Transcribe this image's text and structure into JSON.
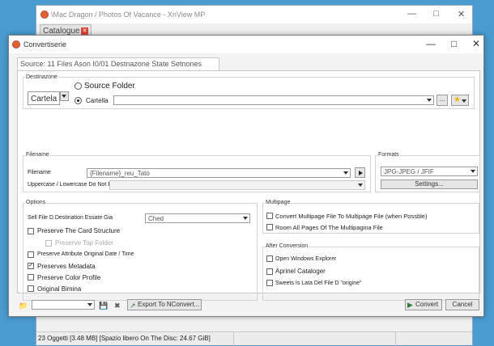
{
  "background_window": {
    "title": "\\Mac Dragon / Photos Of Vacance - XnView MP",
    "tab_label": "Catalogue",
    "status_text": "23 Oggetti [3.48 MB] [Spazio libero On The Disc: 24.67 GiB]"
  },
  "dialog": {
    "title": "Convertiserie",
    "tab_label": "Source: 11 Files Ason I0/01 Destnazone State Setnones",
    "destination": {
      "group_label": "Destinazone",
      "mode_value": "Cartela",
      "source_folder_label": "Source Folder",
      "cartella_label": "Cartella",
      "folder_path": "",
      "browse_label": "..."
    },
    "filename": {
      "group_label": "Filename",
      "filename_label": "Filename",
      "filename_value": "{Filename}_reu_Tato",
      "case_label": "Uppercase / Lowercase Do Not Edit",
      "case_value": ""
    },
    "formats": {
      "group_label": "Formats",
      "format_value": "JPG-JPEG / JFIF",
      "settings_label": "Settings..."
    },
    "options": {
      "group_label": "Options",
      "if_exists_label": "Sell File D Destination Essate Gia",
      "if_exists_value": "Ched",
      "preserve_card_structure": "Preserve The Card Structure",
      "preserve_top_folder": "Preserve Top Folder",
      "preserve_date": "Preserve Attribute Original Date / Time",
      "preserve_metadata": "Preserves Metadata",
      "preserve_color_profile": "Preserve Color Profile",
      "original_delete": "Original Bimina"
    },
    "multipage": {
      "group_label": "Multipage",
      "convert_multipage": "Convert Multipage File To Multipage File (when Possble)",
      "room_all_pages": "Room All Pages Of The Multipagina File"
    },
    "after_conversion": {
      "group_label": "After Conversion",
      "open_explorer": "Open Windows Explorer",
      "open_catalog": "Aprinel Cataloger",
      "sweets_late": "Sweets Is Lata Del File D \"origine\""
    },
    "bottom": {
      "export_label": "Export To NConvert...",
      "convert_label": "Convert",
      "cancel_label": "Cancel"
    }
  },
  "colors": {
    "desktop": "#4a9bd0",
    "app_icon": "#e2632a",
    "close_badge": "#d9453b"
  }
}
